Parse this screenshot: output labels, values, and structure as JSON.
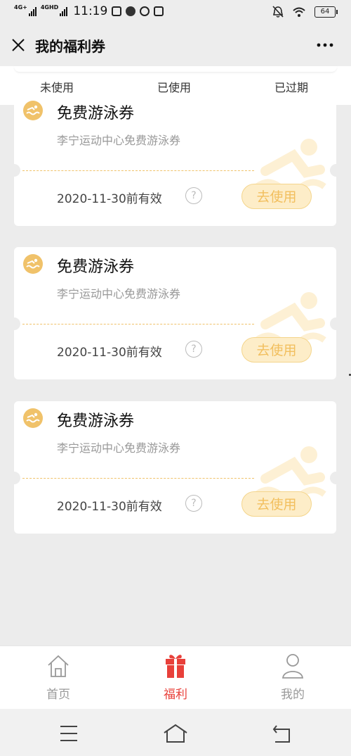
{
  "status": {
    "time": "11:19",
    "network1": "4G+",
    "network2": "4GHD",
    "battery": "64"
  },
  "header": {
    "title": "我的福利券"
  },
  "tabs": [
    {
      "label": "未使用"
    },
    {
      "label": "已使用"
    },
    {
      "label": "已过期"
    }
  ],
  "coupons": [
    {
      "title": "免费游泳券",
      "subtitle": "李宁运动中心免费游泳券",
      "expiry": "2020-11-30前有效",
      "help": "?",
      "action": "去使用"
    },
    {
      "title": "免费游泳券",
      "subtitle": "李宁运动中心免费游泳券",
      "expiry": "2020-11-30前有效",
      "help": "?",
      "action": "去使用"
    },
    {
      "title": "免费游泳券",
      "subtitle": "李宁运动中心免费游泳券",
      "expiry": "2020-11-30前有效",
      "help": "?",
      "action": "去使用"
    }
  ],
  "bottom_nav": [
    {
      "label": "首页",
      "icon": "home-icon",
      "active": false
    },
    {
      "label": "福利",
      "icon": "gift-icon",
      "active": true
    },
    {
      "label": "我的",
      "icon": "person-icon",
      "active": false
    }
  ],
  "system_nav": {
    "icons": [
      "menu-icon",
      "home-outline-icon",
      "back-icon"
    ]
  },
  "colors": {
    "accent": "#e8403a",
    "coupon_gold": "#f0c26a",
    "inactive": "#999999"
  }
}
